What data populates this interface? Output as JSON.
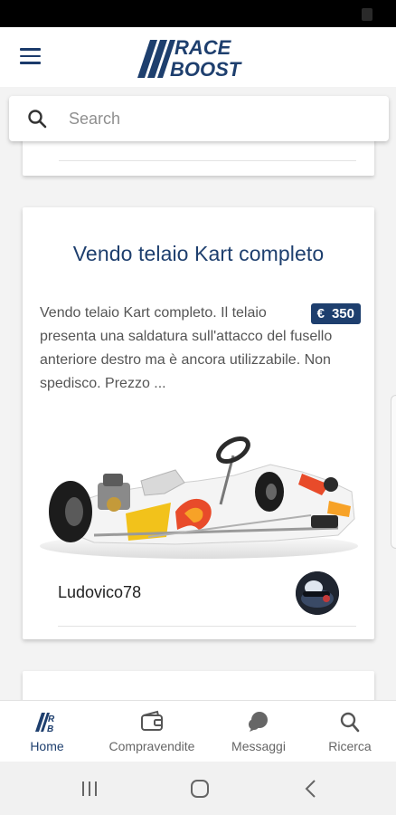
{
  "app": {
    "logo_line1": "RACE",
    "logo_line2": "BOOST",
    "brand_color": "#1e3f6e"
  },
  "search": {
    "placeholder": "Search",
    "value": ""
  },
  "listing": {
    "title": "Vendo telaio Kart completo",
    "description": "Vendo telaio Kart completo. Il telaio presenta una saldatura sull'attacco del fusello anteriore destro ma è ancora utilizzabile. Non spedisco. Prezzo ...",
    "price_currency": "€",
    "price_value": "350",
    "seller": "Ludovico78",
    "image_icon": "kart-photo",
    "avatar_icon": "seller-avatar-photo"
  },
  "bottom_nav": {
    "items": [
      {
        "label": "Home",
        "icon": "race-boost-home-icon",
        "active": true
      },
      {
        "label": "Compravendite",
        "icon": "wallet-icon",
        "active": false
      },
      {
        "label": "Messaggi",
        "icon": "chat-bubble-icon",
        "active": false
      },
      {
        "label": "Ricerca",
        "icon": "search-icon",
        "active": false
      }
    ]
  },
  "system_nav": {
    "items": [
      "recent-apps-icon",
      "home-circle-icon",
      "back-icon"
    ]
  }
}
